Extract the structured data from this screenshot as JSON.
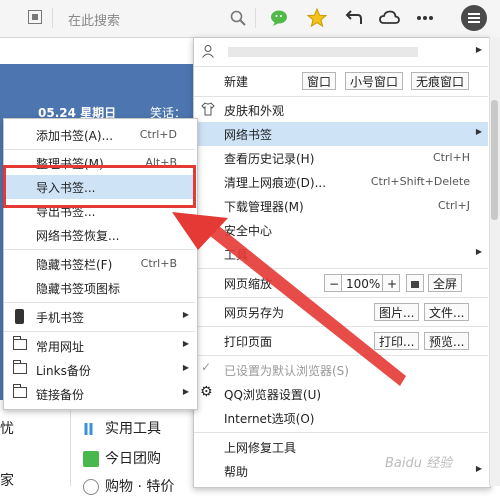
{
  "toolbar": {
    "search_placeholder": "在此搜索",
    "icons": [
      "qr-code-icon",
      "search-icon",
      "wechat-icon",
      "star-icon",
      "undo-icon",
      "cloud-icon",
      "more-icon",
      "menu-icon"
    ]
  },
  "page": {
    "date": "05.24 星期日",
    "joke": "笑话：",
    "left_fragment_1": "忧",
    "left_fragment_2": "家",
    "tools": [
      "实用工具",
      "今日团购",
      "购物 · 特价"
    ]
  },
  "main_menu": {
    "new_label": "新建",
    "new_buttons": [
      "窗口",
      "小号窗口",
      "无痕窗口"
    ],
    "items": [
      {
        "label": "皮肤和外观",
        "shortcut": ""
      },
      {
        "label": "网络书签",
        "shortcut": ""
      },
      {
        "label": "查看历史记录(H)",
        "shortcut": "Ctrl+H"
      },
      {
        "label": "清理上网痕迹(D)...",
        "shortcut": "Ctrl+Shift+Delete"
      },
      {
        "label": "下载管理器(M)",
        "shortcut": "Ctrl+J"
      },
      {
        "label": "安全中心",
        "shortcut": ""
      },
      {
        "label": "工具",
        "shortcut": ""
      }
    ],
    "zoom": {
      "label": "网页缩放",
      "minus": "−",
      "value": "100%",
      "plus": "+",
      "fullscreen": "全屏"
    },
    "save_as": {
      "label": "网页另存为",
      "btn1": "图片...",
      "btn2": "文件..."
    },
    "print": {
      "label": "打印页面",
      "btn1": "打印...",
      "btn2": "预览..."
    },
    "default_browser": "已设置为默认浏览器(S)",
    "qq_settings": "QQ浏览器设置(U)",
    "internet_options": "Internet选项(O)",
    "repair": "上网修复工具",
    "help": "帮助"
  },
  "bookmark_menu": {
    "items": [
      {
        "label": "添加书签(A)...",
        "shortcut": "Ctrl+D"
      },
      {
        "label": "整理书签(M)...",
        "shortcut": "Alt+B"
      },
      {
        "label": "导入书签...",
        "shortcut": ""
      },
      {
        "label": "导出书签...",
        "shortcut": ""
      },
      {
        "label": "网络书签恢复...",
        "shortcut": ""
      },
      {
        "label": "隐藏书签栏(F)",
        "shortcut": "Ctrl+B"
      },
      {
        "label": "隐藏书签项图标",
        "shortcut": ""
      },
      {
        "label": "手机书签",
        "shortcut": ""
      },
      {
        "label": "常用网址",
        "shortcut": ""
      },
      {
        "label": "Links备份",
        "shortcut": ""
      },
      {
        "label": "链接备份",
        "shortcut": ""
      }
    ]
  },
  "watermark": "Baidu 经验",
  "colors": {
    "highlight": "#cfe3f7",
    "annotation": "#e53935",
    "banner": "#4d76b0"
  }
}
